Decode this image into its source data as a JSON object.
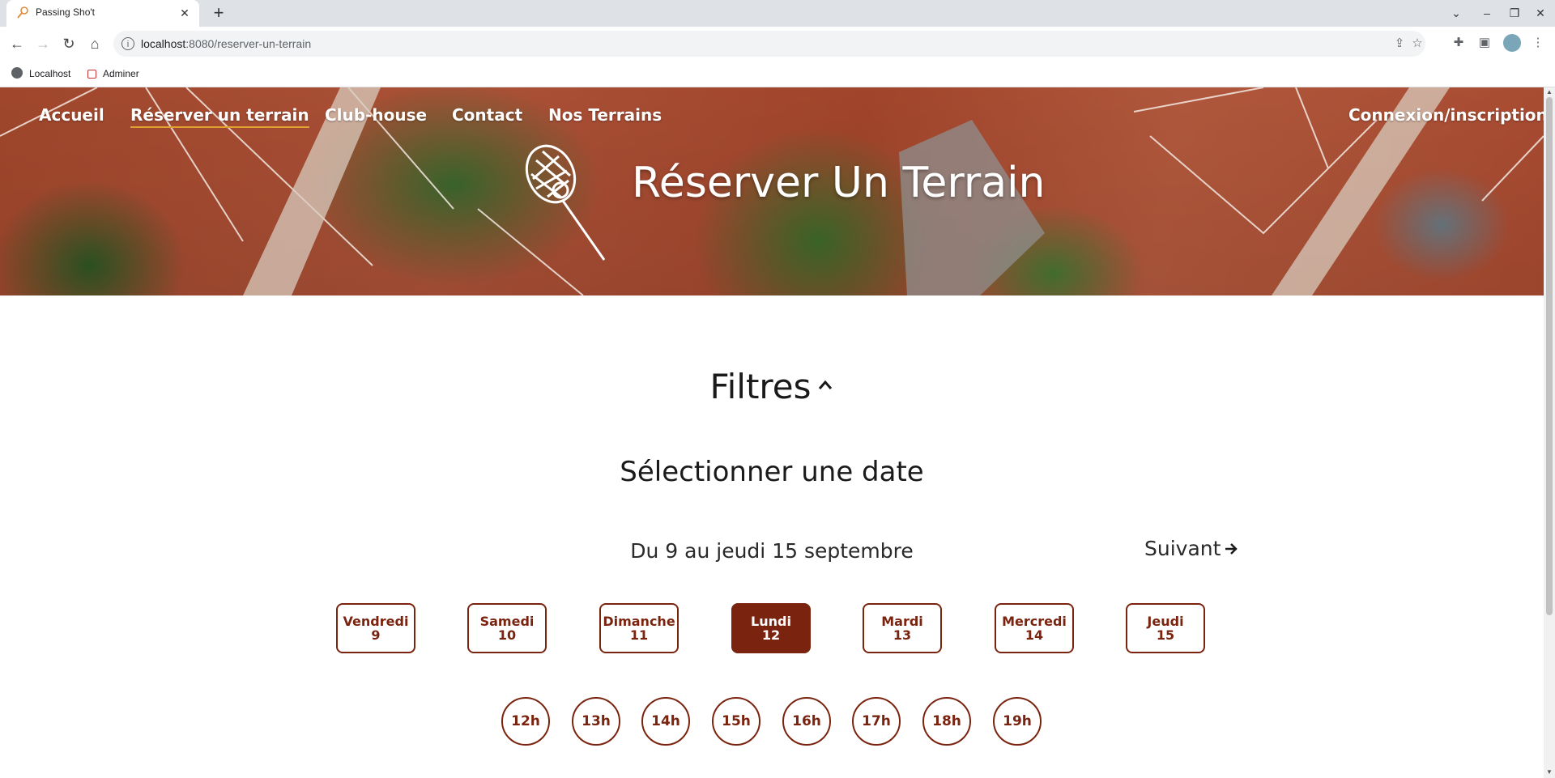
{
  "browser": {
    "tab_title": "Passing Sho't",
    "url_host": "localhost",
    "url_path": ":8080/reserver-un-terrain",
    "bookmarks": [
      "Localhost",
      "Adminer"
    ]
  },
  "nav": {
    "items": [
      "Accueil",
      "Réserver un terrain",
      "Club-house",
      "Contact",
      "Nos Terrains"
    ],
    "active": "Réserver un terrain",
    "login": "Connexion/inscription"
  },
  "hero": {
    "title": "Réserver Un Terrain"
  },
  "filters": {
    "title": "Filtres",
    "select_date_title": "Sélectionner une date",
    "range_label": "Du 9 au jeudi 15 septembre",
    "next_label": "Suivant",
    "days": [
      {
        "name": "Vendredi",
        "num": "9"
      },
      {
        "name": "Samedi",
        "num": "10"
      },
      {
        "name": "Dimanche",
        "num": "11"
      },
      {
        "name": "Lundi",
        "num": "12"
      },
      {
        "name": "Mardi",
        "num": "13"
      },
      {
        "name": "Mercredi",
        "num": "14"
      },
      {
        "name": "Jeudi",
        "num": "15"
      }
    ],
    "selected_day_index": 3,
    "hours": [
      "12h",
      "13h",
      "14h",
      "15h",
      "16h",
      "17h",
      "18h",
      "19h"
    ]
  },
  "colors": {
    "brand": "#7a2410",
    "nav_underline": "#e0a030"
  }
}
